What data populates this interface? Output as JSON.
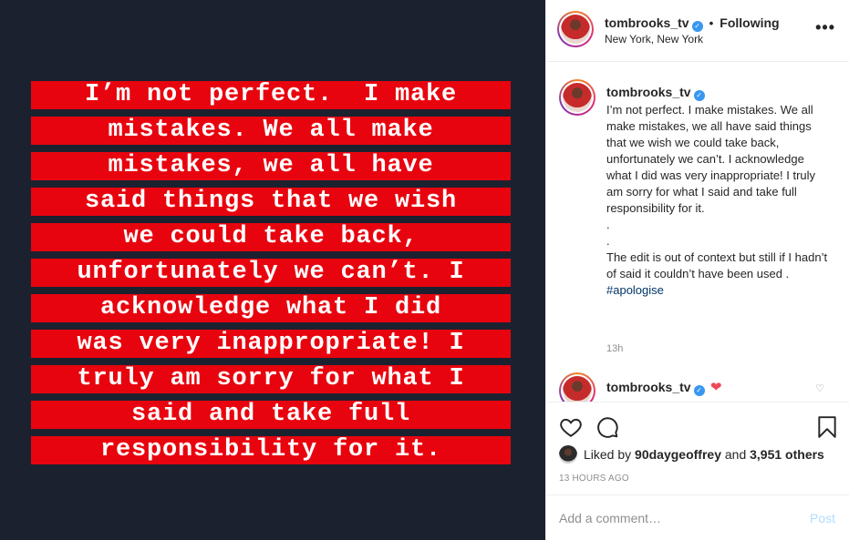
{
  "image_text": {
    "lines": [
      "I’m not perfect.  I make",
      "mistakes. We all make",
      "mistakes, we all have",
      "said things that we wish",
      "we could take back,",
      "unfortunately we can’t. I",
      "acknowledge what I did",
      "was very inappropriate! I",
      "truly am sorry for what I",
      "said and take full",
      "responsibility for it."
    ]
  },
  "header": {
    "username": "tombrooks_tv",
    "separator": "•",
    "follow_status": "Following",
    "location": "New York, New York",
    "more_label": "•••"
  },
  "caption": {
    "username": "tombrooks_tv",
    "text": "I’m not perfect. I make mistakes. We all make mistakes, we all have said things that we wish we could take back, unfortunately we can’t. I acknowledge what I did was very inappropriate! I truly am sorry for what I said and take full responsibility for it.\n.\n.\nThe edit is out of context but still if I hadn’t of said it couldn’t have been used .",
    "hashtag": "#apologise",
    "time": "13h"
  },
  "second_comment": {
    "username": "tombrooks_tv",
    "heart": "❤"
  },
  "likes": {
    "prefix": "Liked by",
    "user": "90daygeoffrey",
    "conjunction": "and",
    "others": "3,951 others"
  },
  "timestamp": "13 HOURS AGO",
  "comment_box": {
    "placeholder": "Add a comment…",
    "post_label": "Post"
  },
  "colors": {
    "image_bg": "#1c2130",
    "highlight_red": "#e8040e",
    "verified_blue": "#3897f0",
    "hashtag": "#003569",
    "post_disabled": "#b3dbff"
  }
}
